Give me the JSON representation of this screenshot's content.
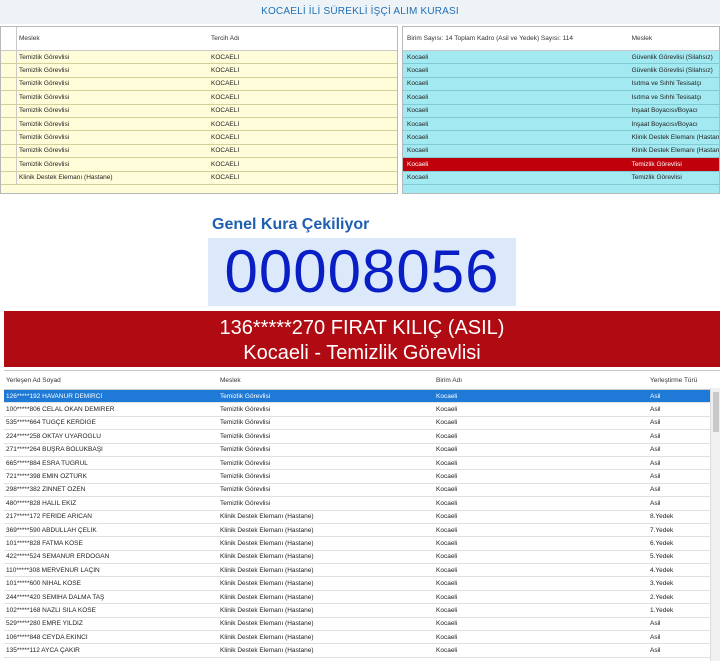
{
  "title": "KOCAELİ İLİ SÜREKLİ İŞÇİ ALIM KURASI",
  "left_panel": {
    "headers": [
      "Meslek",
      "Tercih Adı"
    ],
    "rows": [
      [
        "Temizlik Görevlisi",
        "KOCAELİ"
      ],
      [
        "Temizlik Görevlisi",
        "KOCAELİ"
      ],
      [
        "Temizlik Görevlisi",
        "KOCAELİ"
      ],
      [
        "Temizlik Görevlisi",
        "KOCAELİ"
      ],
      [
        "Temizlik Görevlisi",
        "KOCAELİ"
      ],
      [
        "Temizlik Görevlisi",
        "KOCAELİ"
      ],
      [
        "Temizlik Görevlisi",
        "KOCAELİ"
      ],
      [
        "Temizlik Görevlisi",
        "KOCAELİ"
      ],
      [
        "Temizlik Görevlisi",
        "KOCAELİ"
      ],
      [
        "Klinik Destek Elemanı (Hastane)",
        "KOCAELİ"
      ]
    ]
  },
  "right_panel": {
    "headers": [
      "Birim Sayısı: 14 Toplam Kadro (Asil ve Yedek) Sayısı: 114",
      "Meslek"
    ],
    "rows": [
      [
        "Kocaeli",
        "Güvenlik Görevlisi (Silahsız)"
      ],
      [
        "Kocaeli",
        "Güvenlik Görevlisi (Silahsız)"
      ],
      [
        "Kocaeli",
        "Isıtma ve Sıhhi Tesisatçı"
      ],
      [
        "Kocaeli",
        "Isıtma ve Sıhhi Tesisatçı"
      ],
      [
        "Kocaeli",
        "İnşaat Boyacısı/Boyacı"
      ],
      [
        "Kocaeli",
        "İnşaat Boyacısı/Boyacı"
      ],
      [
        "Kocaeli",
        "Klinik Destek Elemanı (Hastane)"
      ],
      [
        "Kocaeli",
        "Klinik Destek Elemanı (Hastane)"
      ],
      [
        "Kocaeli",
        "Temizlik Görevlisi"
      ],
      [
        "Kocaeli",
        "Temizlik Görevlisi"
      ]
    ],
    "selected_row": 8
  },
  "draw": {
    "label": "Genel Kura Çekiliyor",
    "counter": "00008056"
  },
  "winner": {
    "line1": "136*****270 FIRAT KILIÇ (ASIL)",
    "line2": "Kocaeli - Temizlik Görevlisi"
  },
  "bottom_grid": {
    "headers": [
      "Yerleşen Ad Soyad",
      "Meslek",
      "Birim Adı",
      "Yerleştirme Türü"
    ],
    "rows": [
      [
        "126*****192 HAVANUR DEMİRCİ",
        "Temizlik Görevlisi",
        "Kocaeli",
        "Asil"
      ],
      [
        "100*****806 CELAL OKAN DEMİRER",
        "Temizlik Görevlisi",
        "Kocaeli",
        "Asil"
      ],
      [
        "535*****664 TUĞÇE KERDİĞE",
        "Temizlik Görevlisi",
        "Kocaeli",
        "Asil"
      ],
      [
        "224*****258 OKTAY UYAROĞLU",
        "Temizlik Görevlisi",
        "Kocaeli",
        "Asil"
      ],
      [
        "271*****264 BÜŞRA BÖLÜKBAŞI",
        "Temizlik Görevlisi",
        "Kocaeli",
        "Asil"
      ],
      [
        "665*****884 ESRA TUĞRUL",
        "Temizlik Görevlisi",
        "Kocaeli",
        "Asil"
      ],
      [
        "721*****398 EMİN ÖZTÜRK",
        "Temizlik Görevlisi",
        "Kocaeli",
        "Asil"
      ],
      [
        "298*****382 ZİNNET ÖZEN",
        "Temizlik Görevlisi",
        "Kocaeli",
        "Asil"
      ],
      [
        "480*****828 HALİL EKİZ",
        "Temizlik Görevlisi",
        "Kocaeli",
        "Asil"
      ],
      [
        "217*****172 FERİDE ARICAN",
        "Klinik Destek Elemanı (Hastane)",
        "Kocaeli",
        "8.Yedek"
      ],
      [
        "369*****590 ABDULLAH ÇELİK",
        "Klinik Destek Elemanı (Hastane)",
        "Kocaeli",
        "7.Yedek"
      ],
      [
        "101*****828 FATMA KÖSE",
        "Klinik Destek Elemanı (Hastane)",
        "Kocaeli",
        "6.Yedek"
      ],
      [
        "422*****524 SEMANUR ERDOĞAN",
        "Klinik Destek Elemanı (Hastane)",
        "Kocaeli",
        "5.Yedek"
      ],
      [
        "110*****308 MERVENUR LAÇİN",
        "Klinik Destek Elemanı (Hastane)",
        "Kocaeli",
        "4.Yedek"
      ],
      [
        "101*****600 NİHAL KÖSE",
        "Klinik Destek Elemanı (Hastane)",
        "Kocaeli",
        "3.Yedek"
      ],
      [
        "244*****420 SEMİHA DALMA TAŞ",
        "Klinik Destek Elemanı (Hastane)",
        "Kocaeli",
        "2.Yedek"
      ],
      [
        "102*****168 NAZLI SILA KÖSE",
        "Klinik Destek Elemanı (Hastane)",
        "Kocaeli",
        "1.Yedek"
      ],
      [
        "529*****280 EMRE YILDIZ",
        "Klinik Destek Elemanı (Hastane)",
        "Kocaeli",
        "Asil"
      ],
      [
        "106*****848 CEYDA EKİNCİ",
        "Klinik Destek Elemanı (Hastane)",
        "Kocaeli",
        "Asil"
      ],
      [
        "135*****112 AYCA ÇAKIR",
        "Klinik Destek Elemanı (Hastane)",
        "Kocaeli",
        "Asil"
      ]
    ],
    "selected_row": 0
  }
}
